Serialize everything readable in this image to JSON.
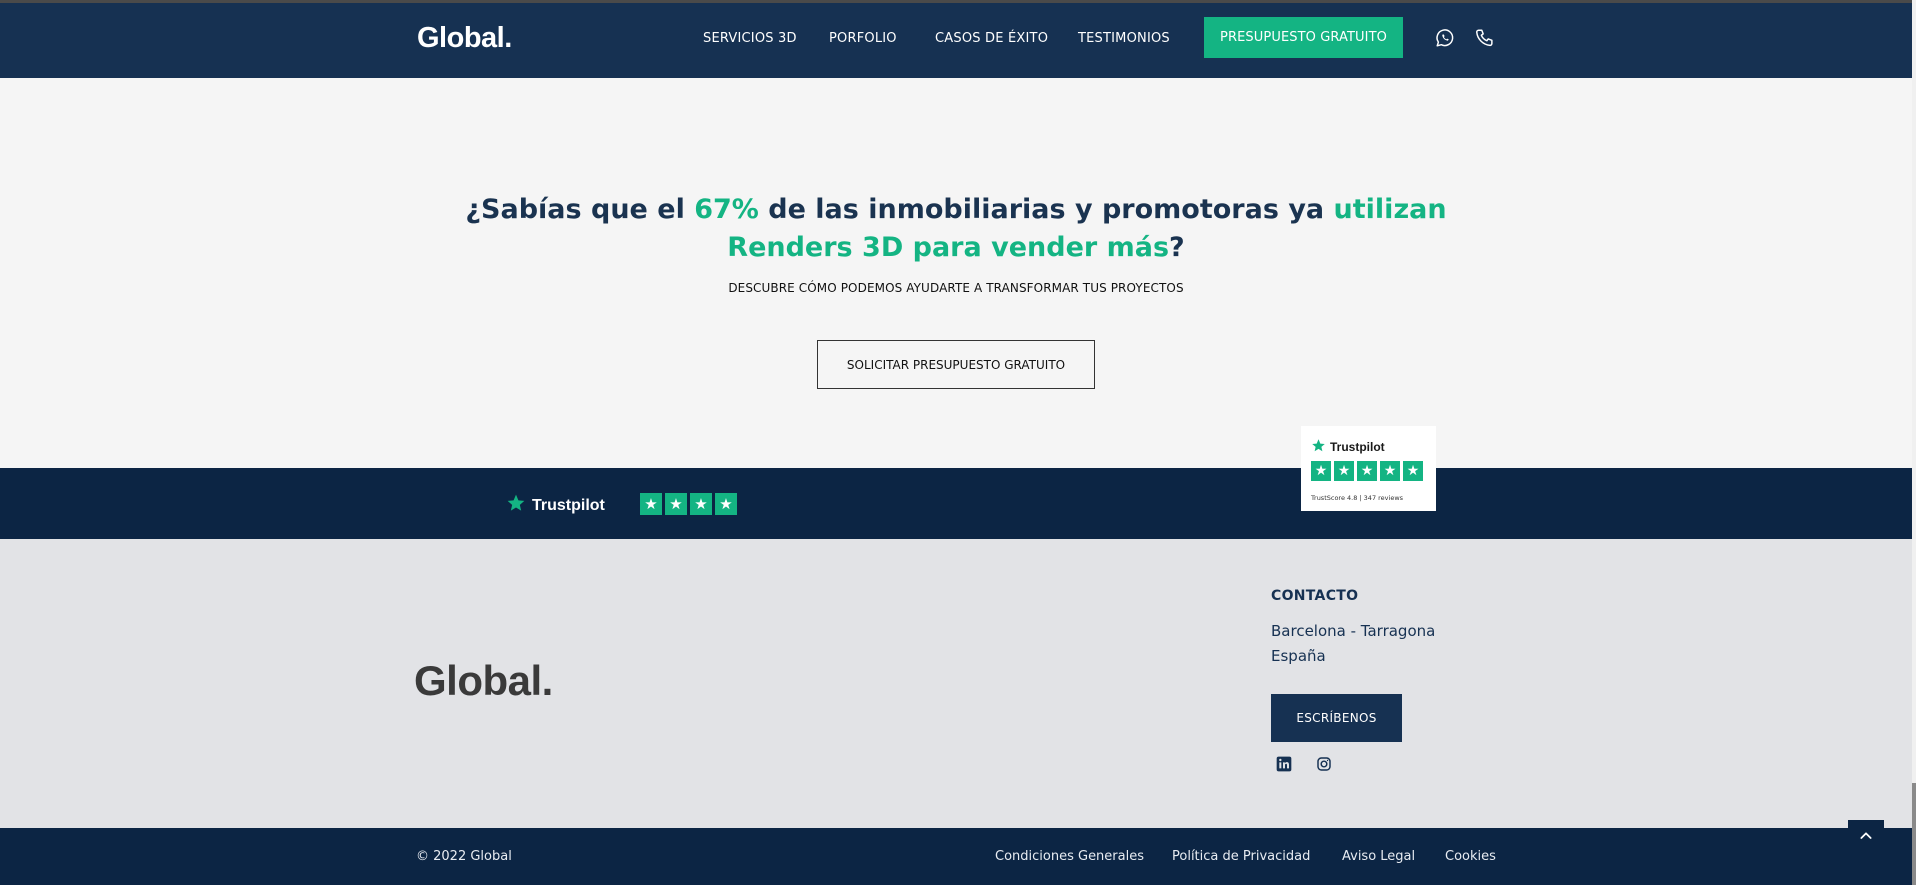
{
  "nav": {
    "logo": "Global.",
    "links": [
      "SERVICIOS 3D",
      "PORFOLIO",
      "CASOS DE ÉXITO",
      "TESTIMONIOS"
    ],
    "cta": "PRESUPUESTO GRATUITO",
    "icons": [
      "whatsapp-icon",
      "phone-icon"
    ]
  },
  "hero": {
    "headline_part1": "¿Sabías que el ",
    "headline_pct": "67%",
    "headline_part2": " de las inmobiliarias y promotoras ya ",
    "headline_accent": "utilizan Renders 3D para vender más",
    "headline_end": "?",
    "subline": "DESCUBRE CÓMO PODEMOS AYUDARTE A TRANSFORMAR TUS PROYECTOS",
    "cta": "SOLICITAR PRESUPUESTO GRATUITO"
  },
  "trustpilot": {
    "brand": "Trustpilot",
    "strip_stars": 4,
    "card_brand": "Trustpilot",
    "card_stars": 5,
    "card_score": "TrustScore 4.8 | 347 reviews"
  },
  "footer": {
    "logo": "Global.",
    "contact_title": "CONTACTO",
    "contact_line1": "Barcelona - Tarragona",
    "contact_line2": "España",
    "write_button": "ESCRÍBENOS",
    "social_icons": [
      "linkedin-icon",
      "instagram-icon"
    ]
  },
  "bottom": {
    "copyright": "© 2022 Global",
    "links": [
      "Condiciones Generales",
      "Política de Privacidad",
      "Aviso Legal",
      "Cookies"
    ]
  },
  "colors": {
    "navy": "#163152",
    "dark_navy": "#0c2544",
    "accent_green": "#14b483",
    "footer_bg": "#e2e3e6"
  }
}
